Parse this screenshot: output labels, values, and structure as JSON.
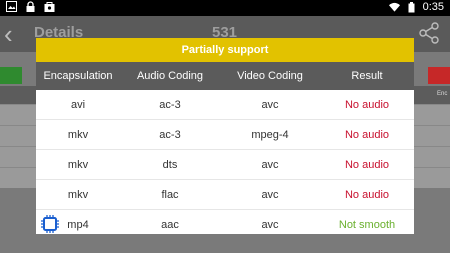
{
  "status_bar": {
    "time": "0:35",
    "icons": [
      "image-notification-icon",
      "lock-icon",
      "store-icon",
      "wifi-icon",
      "battery-icon"
    ]
  },
  "app": {
    "title": "Details",
    "count": "531",
    "background_right_label": "Enc"
  },
  "dialog": {
    "title": "Partially support",
    "columns": [
      "Encapsulation",
      "Audio Coding",
      "Video Coding",
      "Result"
    ],
    "rows": [
      {
        "encapsulation": "avi",
        "audio": "ac-3",
        "video": "avc",
        "result": "No audio"
      },
      {
        "encapsulation": "mkv",
        "audio": "ac-3",
        "video": "mpeg-4",
        "result": "No audio"
      },
      {
        "encapsulation": "mkv",
        "audio": "dts",
        "video": "avc",
        "result": "No audio"
      },
      {
        "encapsulation": "mkv",
        "audio": "flac",
        "video": "avc",
        "result": "No audio"
      },
      {
        "encapsulation": "mp4",
        "audio": "aac",
        "video": "avc",
        "result": "Not smooth"
      }
    ]
  },
  "colors": {
    "header_yellow": "#e2c200",
    "no_audio_red": "#c8102e",
    "not_smooth_green": "#6ab02e",
    "chip_blue": "#1a5fd0"
  }
}
